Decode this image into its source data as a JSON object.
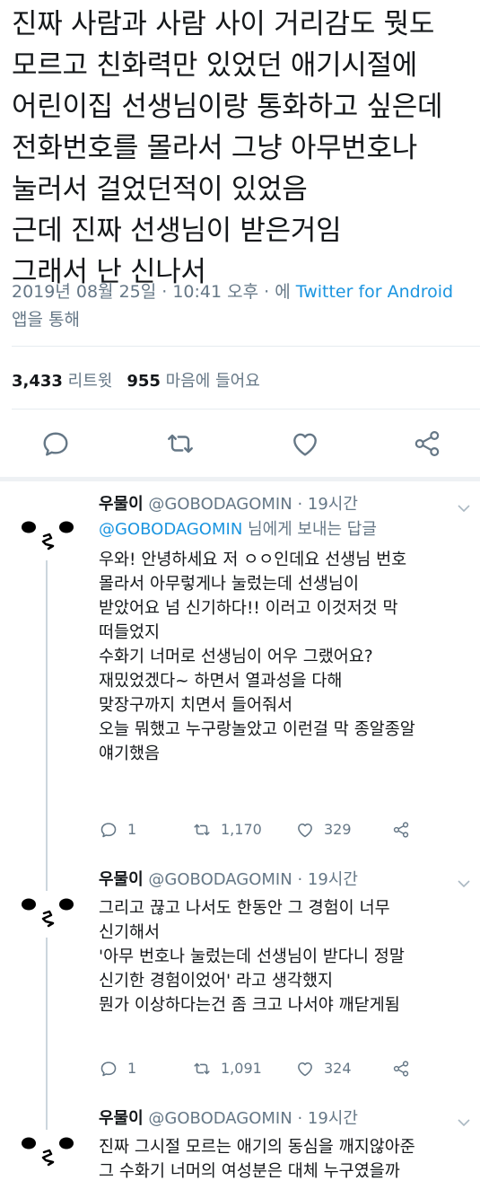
{
  "tweet": {
    "text_lines": [
      "진짜 사람과 사람 사이 거리감도 뭣도",
      "모르고 친화력만 있었던 애기시절에",
      "어린이집 선생님이랑 통화하고 싶은데",
      "전화번호를 몰라서 그냥 아무번호나",
      "눌러서 걸었던적이 있었음",
      "근데 진짜 선생님이 받은거임",
      "그래서 난 신나서"
    ],
    "timestamp": "2019년 08월 25일 · 10:41 오후 · 에",
    "source_link": "Twitter for Android",
    "source_suffix": " 앱을 통해",
    "retweet_count": "3,433",
    "retweet_label": "리트윗",
    "like_count": "955",
    "like_label": "마음에 들어요"
  },
  "replies": [
    {
      "name": "우물이",
      "handle": "@GOBODAGOMIN",
      "time": "· 19시간",
      "reply_to_handle": "@GOBODAGOMIN",
      "reply_to_suffix": " 님에게 보내는 답글",
      "text_lines": [
        "우와! 안녕하세요 저 ㅇㅇ인데요 선생님 번호",
        "몰라서 아무렇게나 눌렀는데 선생님이",
        "받았어요 넘 신기하다!! 이러고 이것저것 막",
        "떠들었지",
        "수화기 너머로 선생님이 어우 그랬어요?",
        "재밌었겠다~ 하면서 열과성을 다해",
        "맞장구까지 치면서 들어줘서",
        "오늘 뭐했고 누구랑놀았고 이런걸 막 종알종알",
        "얘기했음"
      ],
      "reply_count": "1",
      "retweet_count": "1,170",
      "like_count": "329"
    },
    {
      "name": "우물이",
      "handle": "@GOBODAGOMIN",
      "time": "· 19시간",
      "text_lines": [
        "그리고 끊고 나서도 한동안 그 경험이 너무",
        "신기해서",
        "'아무 번호나 눌렀는데 선생님이 받다니 정말",
        "신기한 경험이었어' 라고 생각했지",
        "뭔가 이상하다는건 좀 크고 나서야 깨닫게됨"
      ],
      "reply_count": "1",
      "retweet_count": "1,091",
      "like_count": "324"
    },
    {
      "name": "우물이",
      "handle": "@GOBODAGOMIN",
      "time": "· 19시간",
      "text_lines": [
        "진짜 그시절 모르는 애기의 동심을 깨지않아준",
        "그 수화기 너머의 여성분은 대체 누구였을까"
      ]
    }
  ],
  "icons": {
    "reply": "reply-icon",
    "retweet": "retweet-icon",
    "like": "heart-icon",
    "share": "share-icon",
    "caret": "chevron-down-icon"
  },
  "colors": {
    "text": "#14171a",
    "secondary": "#657786",
    "link": "#1b95e0",
    "divider": "#e6ecf0"
  }
}
